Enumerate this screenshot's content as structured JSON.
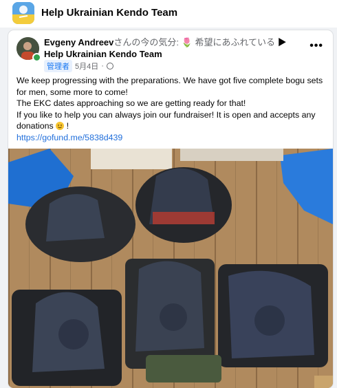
{
  "group": {
    "name": "Help Ukrainian Kendo Team"
  },
  "post": {
    "author": "Evgeny Andreev",
    "feeling_prefix": "さんの今の気分: ",
    "feeling_emoji": "🌷",
    "feeling": " 希望にあふれている",
    "arrow": " ▶ ",
    "group": "Help Ukrainian Kendo Team",
    "role_badge": "管理者",
    "date": "5月4日",
    "dot": "·",
    "more": "•••",
    "text_lines": [
      "We keep progressing with the preparations. We have got five complete bogu sets for men, some more to come!",
      "The EKC dates approaching so we are getting ready for that!",
      "If you like to help you can always join our fundraiser! It is open and accepts any donations"
    ],
    "text_end": " !",
    "link": "https://gofund.me/5838d439"
  },
  "icons": [
    "group-avatar",
    "globe-icon",
    "more-icon",
    "smile-emoji"
  ]
}
